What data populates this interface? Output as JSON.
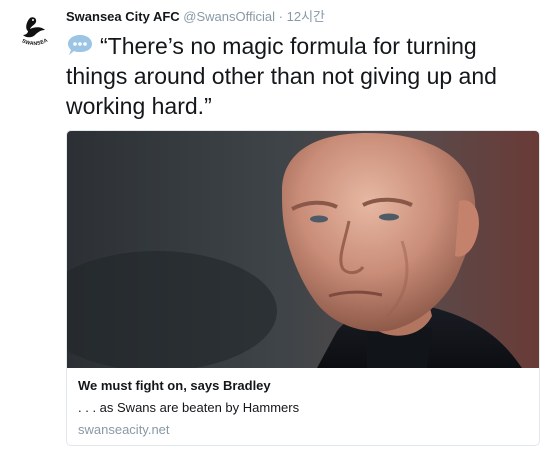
{
  "tweet": {
    "author_name": "Swansea City AFC",
    "author_handle": "@SwansOfficial",
    "separator": "·",
    "timestamp": "12시간",
    "text": "“There’s no magic formula for turning things around other than not giving up and working hard.”",
    "emoji_icon": "speech-balloon-icon"
  },
  "card": {
    "title": "We must fight on, says Bradley",
    "description": ". . . as Swans are beaten by Hammers",
    "domain": "swanseacity.net"
  },
  "avatar": {
    "logo_text": "SWANSEA CITY AFC"
  },
  "colors": {
    "text": "#14171a",
    "muted": "#8899a6",
    "border": "#e1e8ed",
    "emoji": "#9cc4e4"
  }
}
